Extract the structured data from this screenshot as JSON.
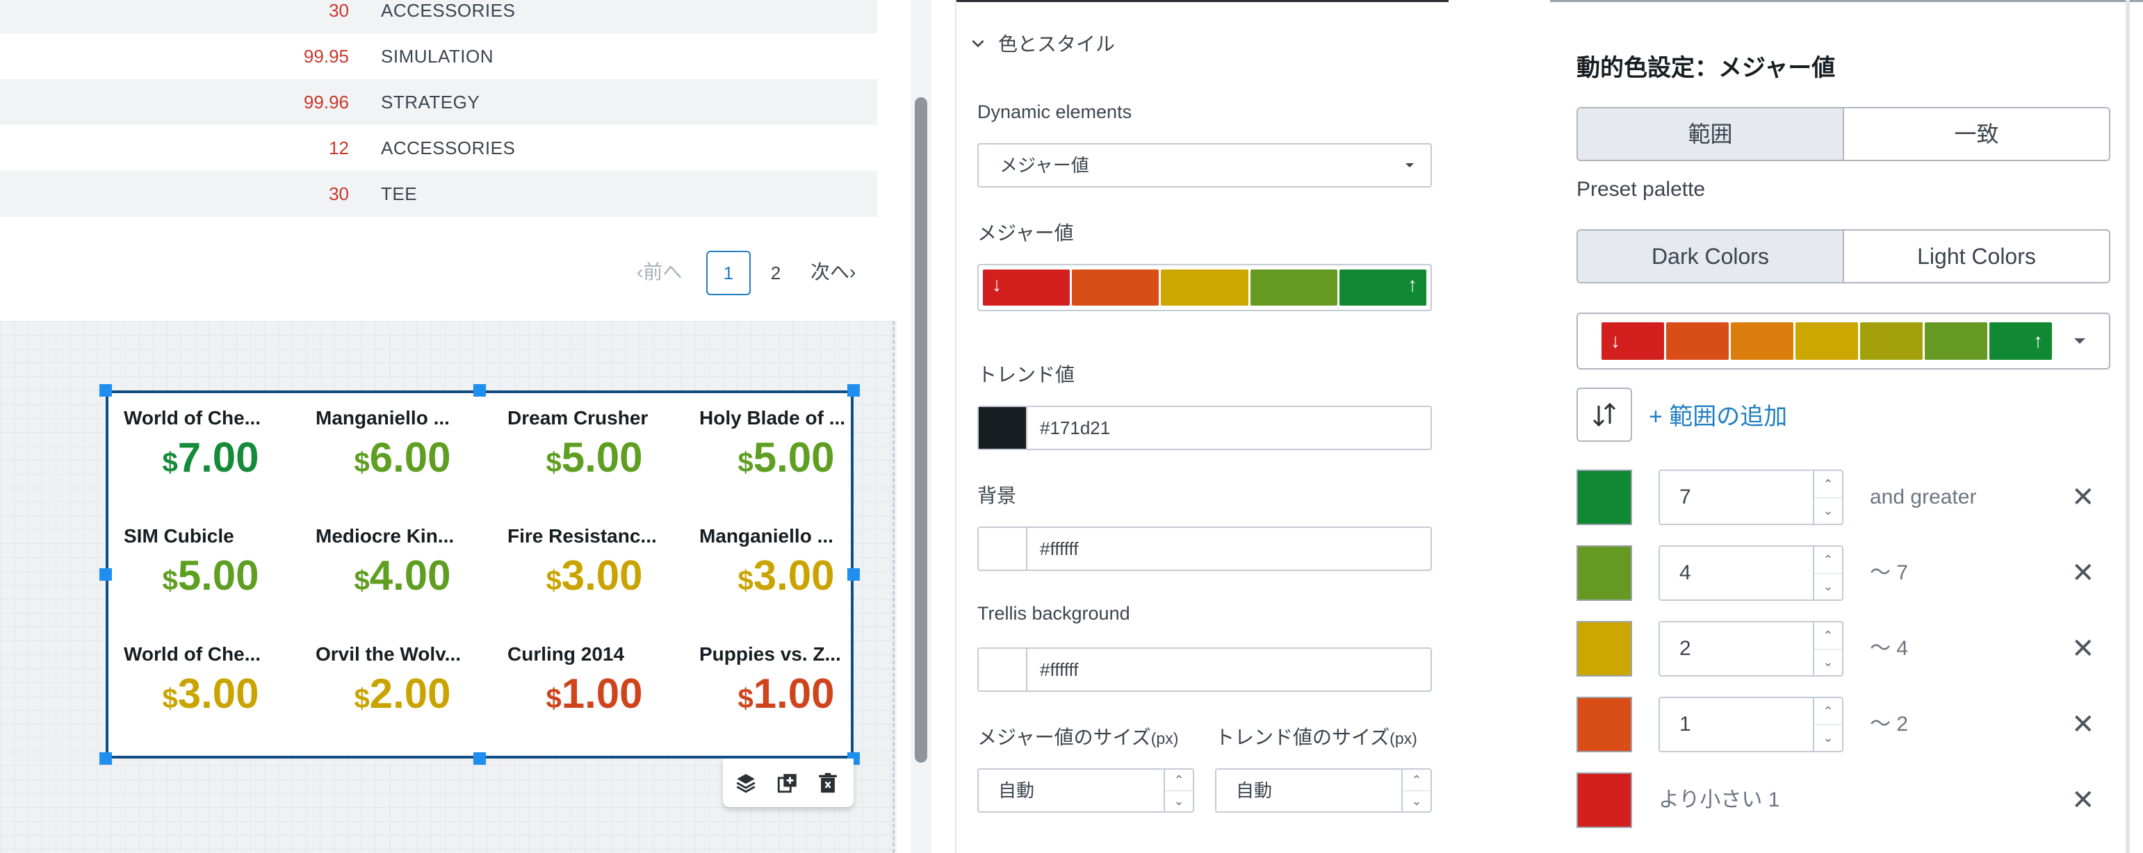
{
  "table": {
    "rows": [
      {
        "price": "30",
        "category": "ACCESSORIES"
      },
      {
        "price": "99.95",
        "category": "SIMULATION"
      },
      {
        "price": "99.96",
        "category": "STRATEGY"
      },
      {
        "price": "12",
        "category": "ACCESSORIES"
      },
      {
        "price": "30",
        "category": "TEE"
      }
    ]
  },
  "pager": {
    "prev": "‹前へ",
    "pages": [
      "1",
      "2"
    ],
    "next": "次へ›"
  },
  "trellis": {
    "currency": "$",
    "tiles": [
      {
        "name": "World of Che...",
        "value": "7.00",
        "color": "#158b3a"
      },
      {
        "name": "Manganiello ...",
        "value": "6.00",
        "color": "#5e9e21"
      },
      {
        "name": "Dream Crusher",
        "value": "5.00",
        "color": "#5e9e21"
      },
      {
        "name": "Holy Blade of ...",
        "value": "5.00",
        "color": "#5e9e21"
      },
      {
        "name": "SIM Cubicle",
        "value": "5.00",
        "color": "#5e9e21"
      },
      {
        "name": "Mediocre Kin...",
        "value": "4.00",
        "color": "#5e9e21"
      },
      {
        "name": "Fire Resistanc...",
        "value": "3.00",
        "color": "#c9a400"
      },
      {
        "name": "Manganiello ...",
        "value": "3.00",
        "color": "#c9a400"
      },
      {
        "name": "World of Che...",
        "value": "3.00",
        "color": "#c9a400"
      },
      {
        "name": "Orvil the Wolv...",
        "value": "2.00",
        "color": "#c9a400"
      },
      {
        "name": "Curling 2014",
        "value": "1.00",
        "color": "#d0441c"
      },
      {
        "name": "Puppies vs. Z...",
        "value": "1.00",
        "color": "#d0441c"
      }
    ],
    "toolbar_icons": [
      "layers-icon",
      "clone-icon",
      "trash-icon"
    ]
  },
  "style_panel": {
    "section_title": "色とスタイル",
    "dynamic_elements_label": "Dynamic elements",
    "dynamic_elements_value": "メジャー値",
    "major_value_label": "メジャー値",
    "major_palette": [
      "#d41f1f",
      "#d94e17",
      "#cba700",
      "#669922",
      "#118832"
    ],
    "trend_label": "トレンド値",
    "trend_color": "#171d21",
    "trend_value": "#171d21",
    "background_label": "背景",
    "background_color": "#ffffff",
    "background_value": "#ffffff",
    "trellis_bg_label": "Trellis background",
    "trellis_bg_color": "#ffffff",
    "trellis_bg_value": "#ffffff",
    "major_size_label": "メジャー値のサイズ",
    "major_size_unit": "(px)",
    "major_size_value": "自動",
    "trend_size_label": "トレンド値のサイズ",
    "trend_size_unit": "(px)",
    "trend_size_value": "自動"
  },
  "dynamic_color": {
    "title": "動的色設定：メジャー値",
    "mode_options": [
      "範囲",
      "一致"
    ],
    "mode_selected": "範囲",
    "preset_label": "Preset palette",
    "preset_options": [
      "Dark Colors",
      "Light Colors"
    ],
    "preset_selected": "Dark Colors",
    "palette": [
      "#d41f1f",
      "#d94e17",
      "#dc7e0d",
      "#cba700",
      "#a3a00b",
      "#669922",
      "#118832"
    ],
    "add_range_label": "+ 範囲の追加",
    "ranges": [
      {
        "color": "#118832",
        "value": "7",
        "label": "and greater"
      },
      {
        "color": "#669922",
        "value": "4",
        "label": "〜 7"
      },
      {
        "color": "#cba700",
        "value": "2",
        "label": "〜 4"
      },
      {
        "color": "#d94e17",
        "value": "1",
        "label": "〜 2"
      },
      {
        "color": "#d41f1f",
        "value": "",
        "label": "より小さい 1"
      }
    ]
  }
}
